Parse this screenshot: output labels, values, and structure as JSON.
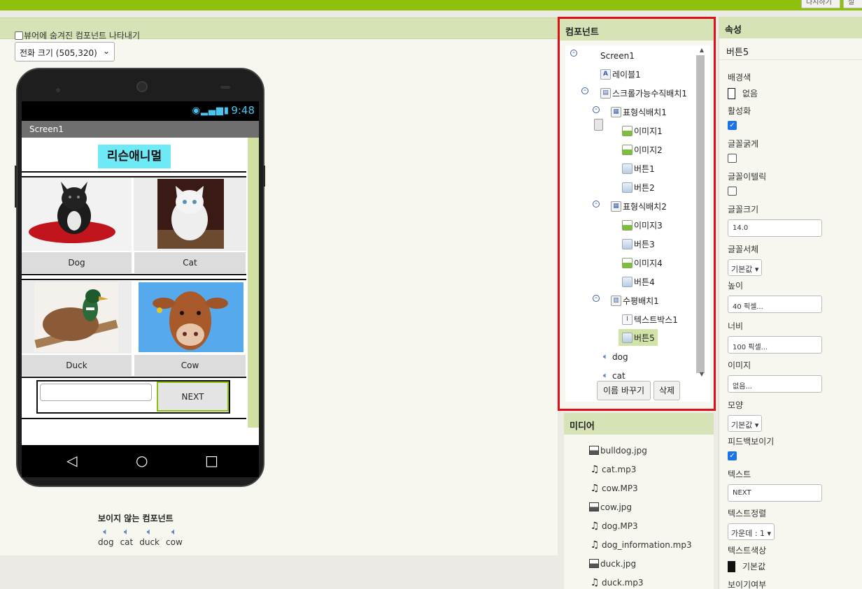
{
  "topbar": {
    "btn1": "다시하기",
    "btn2": "설"
  },
  "viewer": {
    "hidden_check_label": "뷰어에 숨겨진 컴포넌트 나타내기",
    "size_select": "전화 크기 (505,320)",
    "phone": {
      "time": "9:48",
      "screen_title": "Screen1",
      "app_title": "리슨애니멀",
      "buttons": [
        "Dog",
        "Cat",
        "Duck",
        "Cow"
      ],
      "next_button": "NEXT",
      "textbox_value": ""
    },
    "nonvisible_title": "보이지 않는 컴포넌트",
    "nonvisible_items": [
      "dog",
      "cat",
      "duck",
      "cow"
    ]
  },
  "components": {
    "title": "컴포넌트",
    "tree": [
      {
        "label": "Screen1",
        "icon": "screen-icon"
      },
      {
        "label": "레이블1",
        "icon": "label-icon"
      },
      {
        "label": "스크롤가능수직배치1",
        "icon": "vertical-arrangement-icon"
      },
      {
        "label": "표형식배치1",
        "icon": "table-arrangement-icon"
      },
      {
        "label": "이미지1",
        "icon": "image-icon"
      },
      {
        "label": "이미지2",
        "icon": "image-icon"
      },
      {
        "label": "버튼1",
        "icon": "button-icon"
      },
      {
        "label": "버튼2",
        "icon": "button-icon"
      },
      {
        "label": "표형식배치2",
        "icon": "table-arrangement-icon"
      },
      {
        "label": "이미지3",
        "icon": "image-icon"
      },
      {
        "label": "버튼3",
        "icon": "button-icon"
      },
      {
        "label": "이미지4",
        "icon": "image-icon"
      },
      {
        "label": "버튼4",
        "icon": "button-icon"
      },
      {
        "label": "수평배치1",
        "icon": "horizontal-arrangement-icon"
      },
      {
        "label": "텍스트박스1",
        "icon": "textbox-icon"
      },
      {
        "label": "버튼5",
        "icon": "button-icon",
        "selected": true
      },
      {
        "label": "dog",
        "icon": "sound-icon"
      },
      {
        "label": "cat",
        "icon": "sound-icon"
      }
    ],
    "rename_button": "이름 바꾸기",
    "delete_button": "삭제"
  },
  "media": {
    "title": "미디어",
    "files": [
      {
        "name": "bulldog.jpg",
        "icon": "picture-icon"
      },
      {
        "name": "cat.mp3",
        "icon": "music-icon"
      },
      {
        "name": "cow.MP3",
        "icon": "music-icon"
      },
      {
        "name": "cow.jpg",
        "icon": "picture-icon"
      },
      {
        "name": "dog.MP3",
        "icon": "music-icon"
      },
      {
        "name": "dog_information.mp3",
        "icon": "music-icon"
      },
      {
        "name": "duck.jpg",
        "icon": "picture-icon"
      },
      {
        "name": "duck.mp3",
        "icon": "music-icon"
      }
    ]
  },
  "properties": {
    "title": "속성",
    "component": "버튼5",
    "bg_color_label": "배경색",
    "bg_color_value": "없음",
    "enabled_label": "활성화",
    "enabled": true,
    "bold_label": "글꼴굵게",
    "bold": false,
    "italic_label": "글꼴이텔릭",
    "italic": false,
    "font_size_label": "글꼴크기",
    "font_size_value": "14.0",
    "font_face_label": "글꼴서체",
    "font_face_value": "기본값 ▾",
    "height_label": "높이",
    "height_value": "40 픽셀...",
    "width_label": "너비",
    "width_value": "100 픽셀...",
    "image_label": "이미지",
    "image_value": "없음...",
    "shape_label": "모양",
    "shape_value": "기본값 ▾",
    "feedback_label": "피드백보이기",
    "feedback": true,
    "text_label": "텍스트",
    "text_value": "NEXT",
    "align_label": "텍스트정렬",
    "align_value": "가운데 : 1 ▾",
    "text_color_label": "텍스트색상",
    "text_color_value": "기본값",
    "visible_label": "보이기여부"
  },
  "colors": {
    "accent": "#8dc10c",
    "header": "#d5e3b7",
    "highlight_border": "#e0101a"
  }
}
